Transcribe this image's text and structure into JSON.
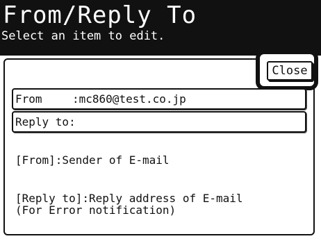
{
  "header": {
    "title": "From/Reply To",
    "subtitle": "Select an item to edit."
  },
  "close_button": {
    "label": "Close"
  },
  "fields": {
    "from": {
      "label": "From",
      "separator": ":",
      "value": "mc860@test.co.jp"
    },
    "reply_to": {
      "label": "Reply to:",
      "value": ""
    }
  },
  "help": {
    "from_line": "[From]:Sender of E-mail",
    "reply_line1": "[Reply to]:Reply address of E-mail",
    "reply_line2": "(For Error notification)"
  },
  "colors": {
    "header_bg": "#111111",
    "header_text": "#ffffff",
    "body_bg": "#ffffff",
    "text": "#111111"
  }
}
